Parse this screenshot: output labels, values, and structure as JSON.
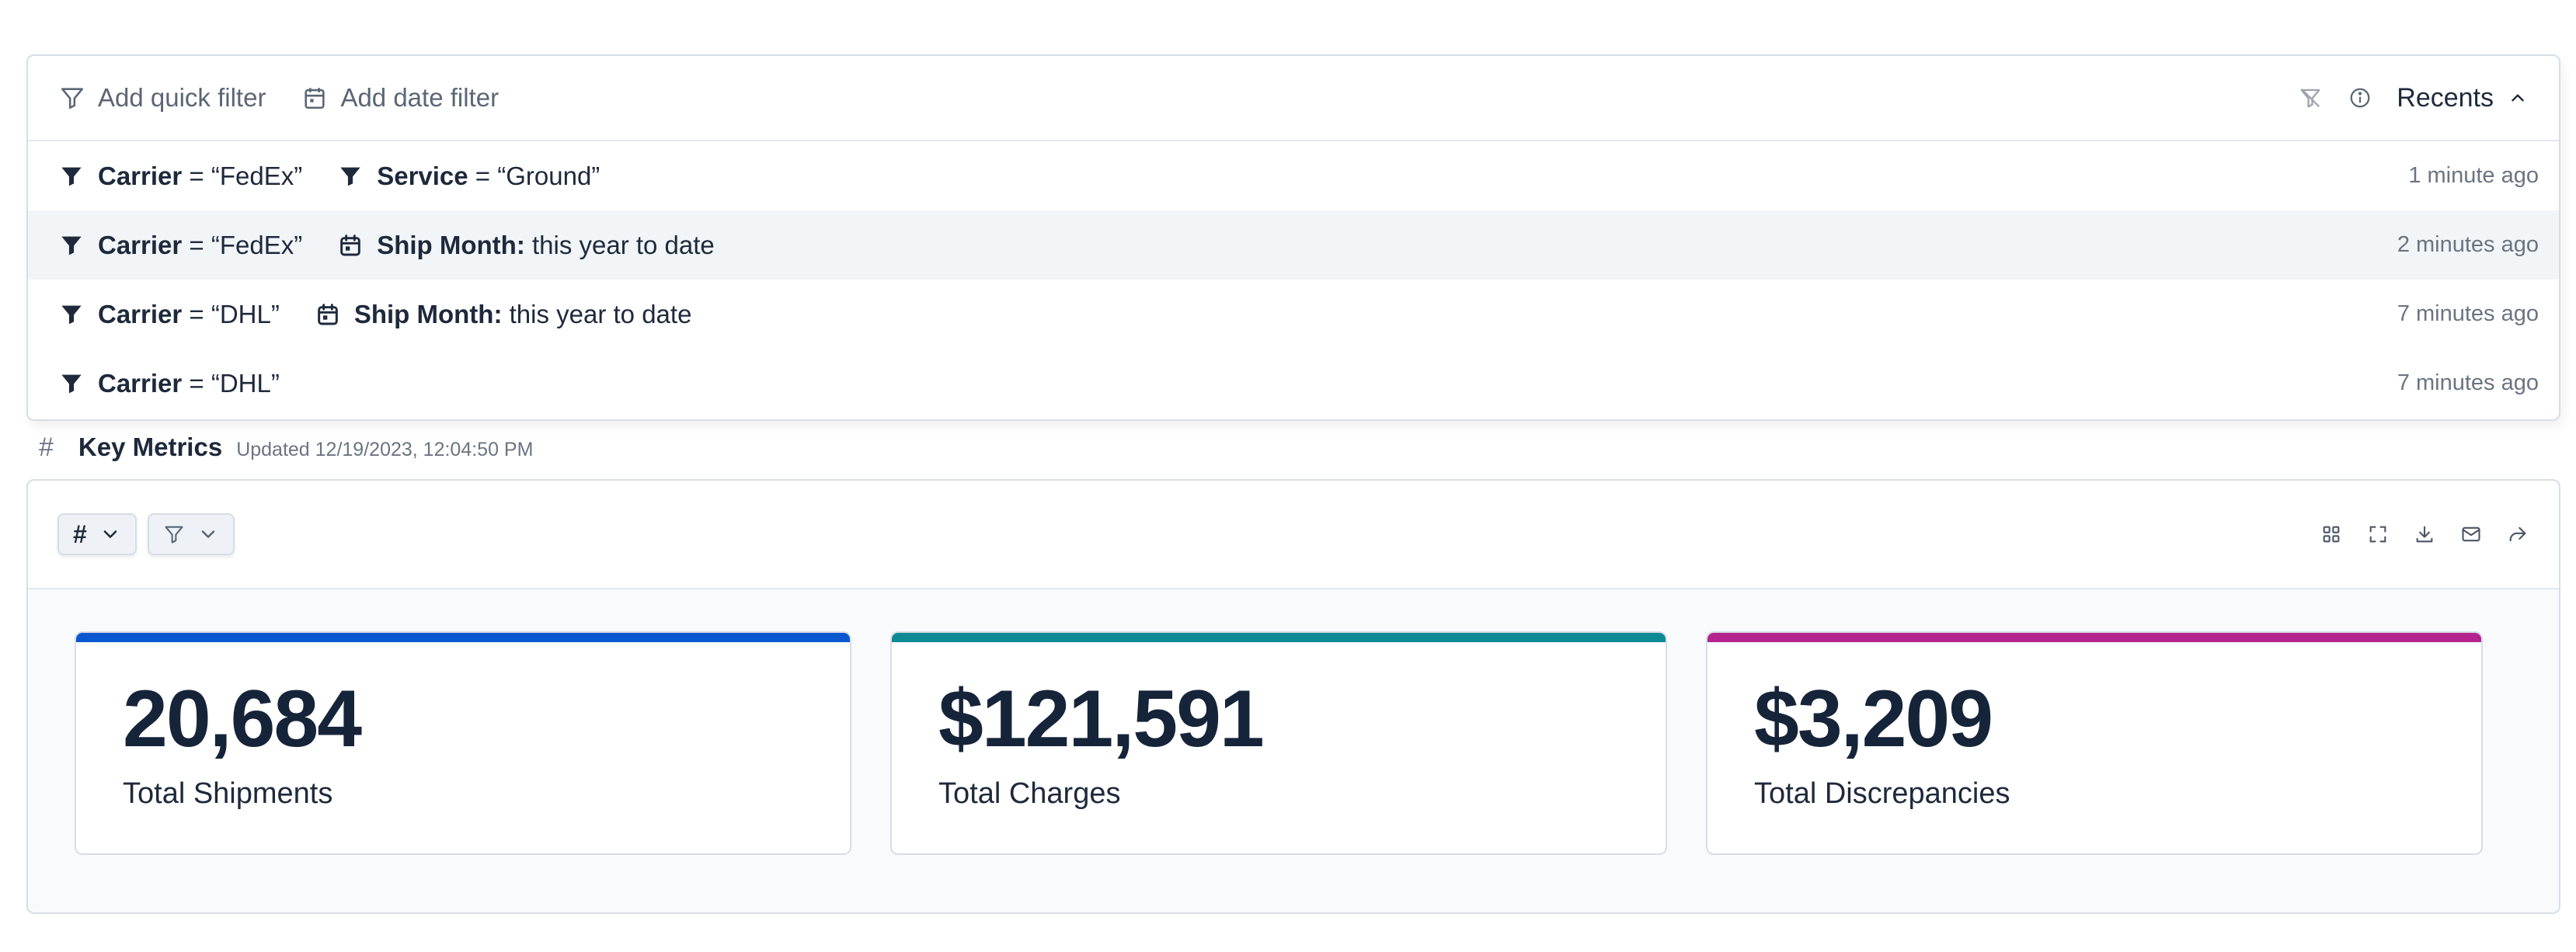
{
  "filter_bar": {
    "add_quick_filter": "Add quick filter",
    "add_date_filter": "Add date filter",
    "recents_label": "Recents"
  },
  "recents": [
    {
      "time": "1 minute ago",
      "highlighted": false,
      "chips": [
        {
          "kind": "filter",
          "bold": "Carrier",
          "rest": " = “FedEx”"
        },
        {
          "kind": "filter",
          "bold": "Service",
          "rest": " = “Ground”"
        }
      ]
    },
    {
      "time": "2 minutes ago",
      "highlighted": true,
      "chips": [
        {
          "kind": "filter",
          "bold": "Carrier",
          "rest": " = “FedEx”"
        },
        {
          "kind": "date",
          "bold": "Ship Month:",
          "rest": " this year to date"
        }
      ]
    },
    {
      "time": "7 minutes ago",
      "highlighted": false,
      "chips": [
        {
          "kind": "filter",
          "bold": "Carrier",
          "rest": " = “DHL”"
        },
        {
          "kind": "date",
          "bold": "Ship Month:",
          "rest": " this year to date"
        }
      ]
    },
    {
      "time": "7 minutes ago",
      "highlighted": false,
      "chips": [
        {
          "kind": "filter",
          "bold": "Carrier",
          "rest": " = “DHL”"
        }
      ]
    }
  ],
  "key_metrics": {
    "hash": "#",
    "title": "Key Metrics",
    "updated": "Updated 12/19/2023, 12:04:50 PM"
  },
  "toolbar": {
    "format_symbol": "#"
  },
  "cards": [
    {
      "value": "20,684",
      "label": "Total Shipments",
      "accent": "#0b57d0"
    },
    {
      "value": "$121,591",
      "label": "Total Charges",
      "accent": "#0e8a94"
    },
    {
      "value": "$3,209",
      "label": "Total Discrepancies",
      "accent": "#b5248e"
    }
  ],
  "colors": {
    "text_dark": "#1e293b",
    "text_muted": "#6b7482",
    "border": "#d7dee6",
    "row_highlight": "#f1f5f8"
  }
}
